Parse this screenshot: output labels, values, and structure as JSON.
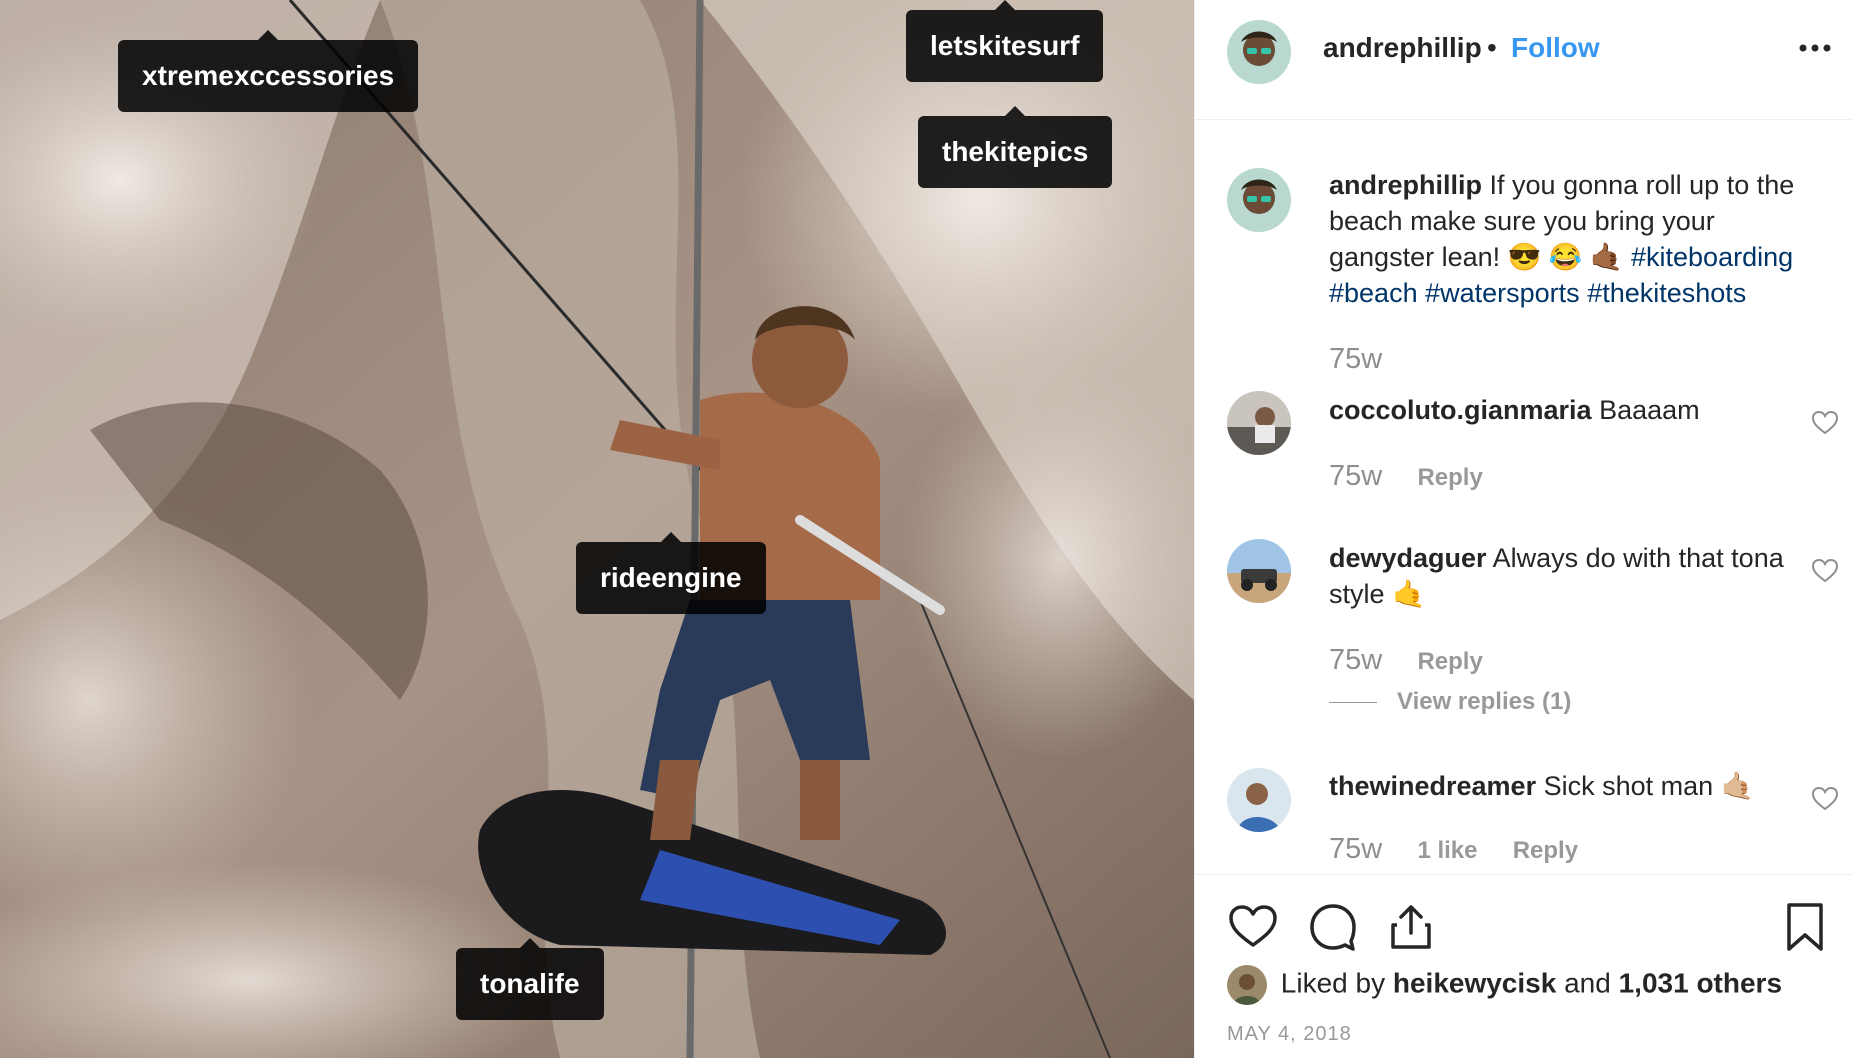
{
  "post": {
    "username": "andrephillip",
    "separator": "•",
    "follow_label": "Follow",
    "more_icon": "more-options-icon"
  },
  "photo": {
    "tags": [
      "xtremexccessories",
      "letskitesurf",
      "thekitepics",
      "rideengine",
      "tonalife"
    ]
  },
  "caption": {
    "username": "andrephillip",
    "text": "If you gonna roll up to the beach make sure you bring your gangster lean! 😎 😂 🤙🏾",
    "hashtags": [
      "#kiteboarding",
      "#beach",
      "#watersports",
      "#thekiteshots"
    ],
    "time": "75w"
  },
  "comments": [
    {
      "username": "coccoluto.gianmaria",
      "text": "Baaaam",
      "time": "75w",
      "likes": "",
      "reply": "Reply"
    },
    {
      "username": "dewydaguer",
      "text": "Always do with that tona style 🤙",
      "time": "75w",
      "likes": "",
      "reply": "Reply",
      "view_replies": "View replies (1)"
    },
    {
      "username": "thewinedreamer",
      "text": "Sick shot man 🤙🏼",
      "time": "75w",
      "likes": "1 like",
      "reply": "Reply"
    }
  ],
  "actions": {
    "icons": [
      "heart-icon",
      "comment-icon",
      "share-icon",
      "bookmark-icon"
    ]
  },
  "likes": {
    "prefix": "Liked by",
    "user": "heikewycisk",
    "middle": "and",
    "count": "1,031 others"
  },
  "date": "MAY 4, 2018",
  "colors": {
    "follow": "#3897f0",
    "hashtag": "#003569",
    "muted": "#8e8e8e"
  }
}
